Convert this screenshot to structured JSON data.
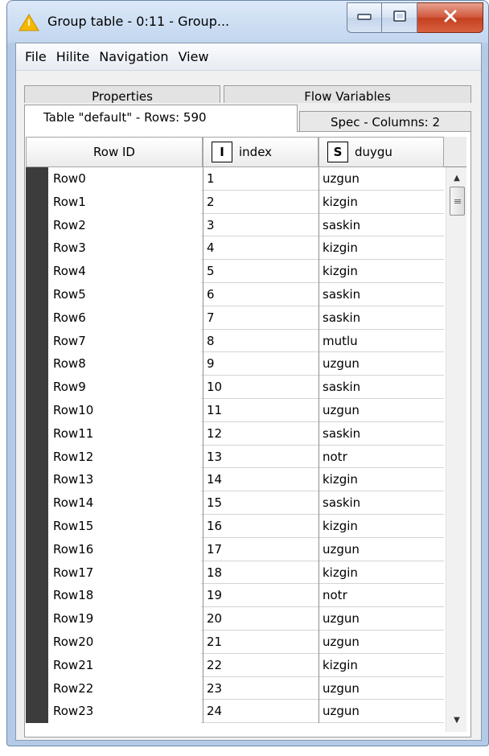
{
  "window": {
    "title": "Group table - 0:11 - Group...",
    "accent": "#f5b800"
  },
  "menu": [
    "File",
    "Hilite",
    "Navigation",
    "View"
  ],
  "tabs_upper": [
    "Properties",
    "Flow Variables"
  ],
  "tabs_lower": {
    "active": "Table \"default\" - Rows: 590",
    "spec": "Spec - Columns: 2"
  },
  "table": {
    "columns": [
      {
        "label": "Row ID",
        "type": ""
      },
      {
        "label": "index",
        "type": "I"
      },
      {
        "label": "duygu",
        "type": "S"
      }
    ],
    "rows": [
      {
        "id": "Row0",
        "index": "1",
        "duygu": "uzgun"
      },
      {
        "id": "Row1",
        "index": "2",
        "duygu": "kizgin"
      },
      {
        "id": "Row2",
        "index": "3",
        "duygu": "saskin"
      },
      {
        "id": "Row3",
        "index": "4",
        "duygu": "kizgin"
      },
      {
        "id": "Row4",
        "index": "5",
        "duygu": "kizgin"
      },
      {
        "id": "Row5",
        "index": "6",
        "duygu": "saskin"
      },
      {
        "id": "Row6",
        "index": "7",
        "duygu": "saskin"
      },
      {
        "id": "Row7",
        "index": "8",
        "duygu": "mutlu"
      },
      {
        "id": "Row8",
        "index": "9",
        "duygu": "uzgun"
      },
      {
        "id": "Row9",
        "index": "10",
        "duygu": "saskin"
      },
      {
        "id": "Row10",
        "index": "11",
        "duygu": "uzgun"
      },
      {
        "id": "Row11",
        "index": "12",
        "duygu": "saskin"
      },
      {
        "id": "Row12",
        "index": "13",
        "duygu": "notr"
      },
      {
        "id": "Row13",
        "index": "14",
        "duygu": "kizgin"
      },
      {
        "id": "Row14",
        "index": "15",
        "duygu": "saskin"
      },
      {
        "id": "Row15",
        "index": "16",
        "duygu": "kizgin"
      },
      {
        "id": "Row16",
        "index": "17",
        "duygu": "uzgun"
      },
      {
        "id": "Row17",
        "index": "18",
        "duygu": "kizgin"
      },
      {
        "id": "Row18",
        "index": "19",
        "duygu": "notr"
      },
      {
        "id": "Row19",
        "index": "20",
        "duygu": "uzgun"
      },
      {
        "id": "Row20",
        "index": "21",
        "duygu": "uzgun"
      },
      {
        "id": "Row21",
        "index": "22",
        "duygu": "kizgin"
      },
      {
        "id": "Row22",
        "index": "23",
        "duygu": "uzgun"
      },
      {
        "id": "Row23",
        "index": "24",
        "duygu": "uzgun"
      }
    ]
  },
  "icons": {
    "app": "knime-warning-triangle-icon",
    "minimize": "minimize-icon",
    "maximize": "maximize-icon",
    "close": "close-icon"
  }
}
